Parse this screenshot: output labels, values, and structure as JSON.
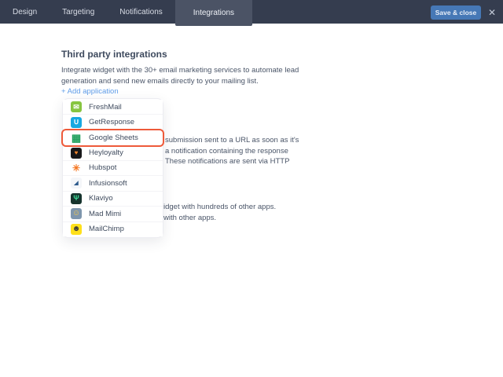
{
  "topbar": {
    "tabs": [
      "Design",
      "Targeting",
      "Notifications",
      "Integrations"
    ],
    "active_tab": "Integrations",
    "save_label": "Save & close",
    "close_icon": "✕"
  },
  "content": {
    "heading": "Third party integrations",
    "description": "Integrate widget with the 30+ email marketing services to automate lead generation and send new emails directly to your mailing list.",
    "add_application_link": "+ Add application"
  },
  "dropdown": {
    "selected": "Google Sheets",
    "highlight_color": "#ee5a3a",
    "items": [
      {
        "label": "FreshMail",
        "icon": {
          "name": "freshmail-icon",
          "bg": "#87c540",
          "fg": "#ffffff",
          "glyph": "✉",
          "size": 9
        }
      },
      {
        "label": "GetResponse",
        "icon": {
          "name": "getresponse-icon",
          "bg": "#17a9e1",
          "fg": "#ffffff",
          "glyph": "∪",
          "size": 10
        }
      },
      {
        "label": "Google Sheets",
        "icon": {
          "name": "google-sheets-icon",
          "bg": "transparent",
          "fg": "#1e9e5a",
          "glyph": "▦",
          "size": 13
        }
      },
      {
        "label": "Heyloyalty",
        "icon": {
          "name": "heyloyalty-icon",
          "bg": "#18181a",
          "fg": "#f5862c",
          "glyph": "♥",
          "size": 8
        }
      },
      {
        "label": "Hubspot",
        "icon": {
          "name": "hubspot-icon",
          "bg": "transparent",
          "fg": "#f57722",
          "glyph": "✳",
          "size": 12
        }
      },
      {
        "label": "Infusionsoft",
        "icon": {
          "name": "infusionsoft-icon",
          "bg": "#f4f6f9",
          "fg": "#2c5a8c",
          "glyph": "◢",
          "size": 7
        }
      },
      {
        "label": "Klaviyo",
        "icon": {
          "name": "klaviyo-icon",
          "bg": "#16332d",
          "fg": "#3ddc97",
          "glyph": "Ψ",
          "size": 9
        }
      },
      {
        "label": "Mad Mimi",
        "icon": {
          "name": "madmimi-icon",
          "bg": "#7e96ad",
          "fg": "#f7c948",
          "glyph": "☺",
          "size": 10
        }
      },
      {
        "label": "MailChimp",
        "icon": {
          "name": "mailchimp-icon",
          "bg": "#ffe01b",
          "fg": "#3a3a3a",
          "glyph": "☻",
          "size": 10
        }
      }
    ]
  },
  "clipped_text_blocks": [
    {
      "lines": [
        "submission sent to a URL as soon as it's",
        "a notification containing the response",
        "These notifications are sent via HTTP"
      ]
    },
    {
      "lines": [
        "idget with hundreds of other apps.",
        "with other apps."
      ]
    }
  ],
  "colors": {
    "topbar_bg": "#353d4f",
    "active_tab_bg": "#4b5365",
    "save_button_bg": "#4678b6",
    "link_blue": "#5e9ce8",
    "highlight_orange": "#ee5a3a"
  }
}
